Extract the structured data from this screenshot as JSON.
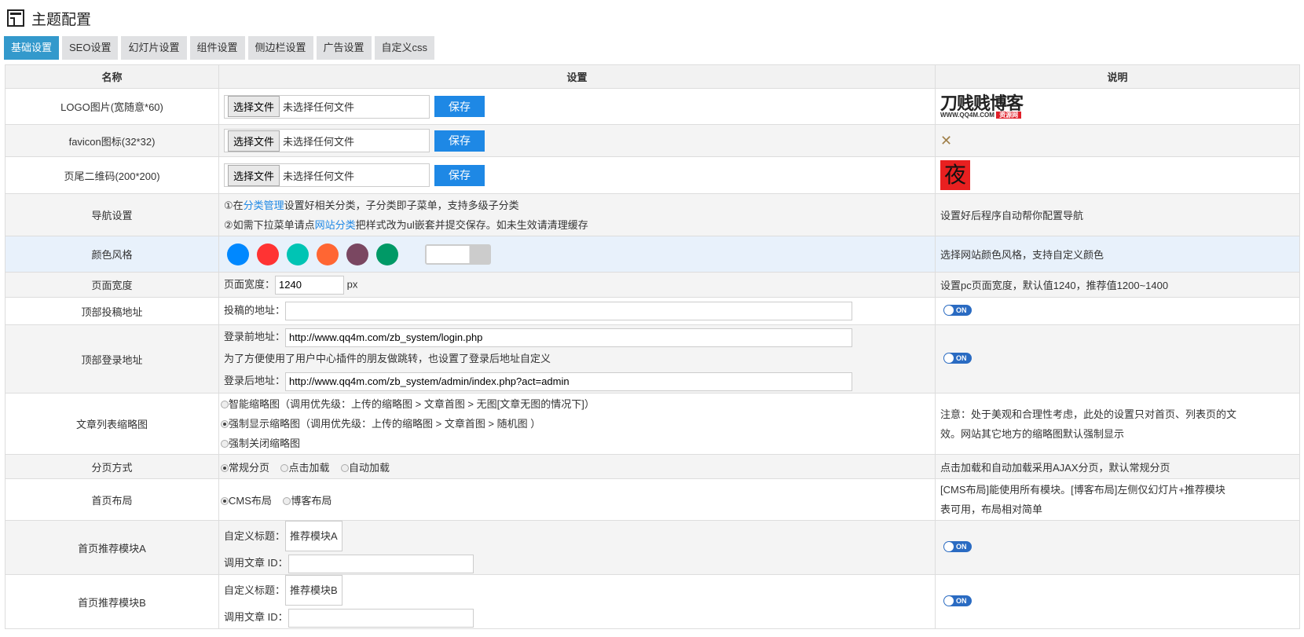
{
  "title": "主题配置",
  "tabs": [
    "基础设置",
    "SEO设置",
    "幻灯片设置",
    "组件设置",
    "侧边栏设置",
    "广告设置",
    "自定义css"
  ],
  "headers": [
    "名称",
    "设置",
    "说明"
  ],
  "file": {
    "choose": "选择文件",
    "none": "未选择任何文件",
    "save": "保存"
  },
  "rows": {
    "logo": "LOGO图片(宽随意*60)",
    "favicon": "favicon图标(32*32)",
    "qr": "页尾二维码(200*200)",
    "logo_img": "刀贱贱博客 WWW.QQ4M.COM",
    "nav": {
      "name": "导航设置",
      "l1a": "①在",
      "l1link": "分类管理",
      "l1b": "设置好相关分类，子分类即子菜单，支持多级子分类",
      "l2a": "②如需下拉菜单请点",
      "l2link": "网站分类",
      "l2b": "把样式改为ul嵌套并提交保存。如未生效请清理缓存",
      "desc": "设置好后程序自动帮你配置导航"
    },
    "color": {
      "name": "颜色风格",
      "swatches": [
        "#0088ff",
        "#ff3333",
        "#00c4b4",
        "#ff6633",
        "#7a4761",
        "#009966"
      ],
      "desc": "选择网站颜色风格，支持自定义颜色"
    },
    "width": {
      "name": "页面宽度",
      "label": "页面宽度：",
      "value": "1240",
      "unit": "px",
      "desc": "设置pc页面宽度，默认值1240，推荐值1200~1400"
    },
    "tougao": {
      "name": "顶部投稿地址",
      "label": "投稿的地址：",
      "value": "",
      "toggle": "ON"
    },
    "login": {
      "name": "顶部登录地址",
      "label1": "登录前地址：",
      "value1": "http://www.qq4m.com/zb_system/login.php",
      "note": "为了方便使用了用户中心插件的朋友做跳转，也设置了登录后地址自定义",
      "label2": "登录后地址：",
      "value2": "http://www.qq4m.com/zb_system/admin/index.php?act=admin",
      "toggle": "ON"
    },
    "thumb": {
      "name": "文章列表缩略图",
      "opts": [
        "智能缩略图（调用优先级：上传的缩略图 > 文章首图 > 无图[文章无图的情况下]）",
        "强制显示缩略图（调用优先级：上传的缩略图 > 文章首图 > 随机图 ）",
        "强制关闭缩略图"
      ],
      "desc1": "注意：处于美观和合理性考虑，此处的设置只对首页、列表页的文",
      "desc2": "效。网站其它地方的缩略图默认强制显示"
    },
    "paging": {
      "name": "分页方式",
      "opts": [
        "常规分页",
        "点击加载",
        "自动加载"
      ],
      "desc": "点击加载和自动加载采用AJAX分页，默认常规分页"
    },
    "layout": {
      "name": "首页布局",
      "opts": [
        "CMS布局",
        "博客布局"
      ],
      "desc1": "[CMS布局]能使用所有模块。[博客布局]左侧仅幻灯片+推荐模块",
      "desc2": "表可用，布局相对简单"
    },
    "modA": {
      "name": "首页推荐模块A",
      "label1": "自定义标题：",
      "value1": "推荐模块A",
      "label2": "调用文章 ID：",
      "toggle": "ON"
    },
    "modB": {
      "name": "首页推荐模块B",
      "label1": "自定义标题：",
      "value1": "推荐模块B",
      "label2": "调用文章 ID：",
      "toggle": "ON"
    }
  }
}
